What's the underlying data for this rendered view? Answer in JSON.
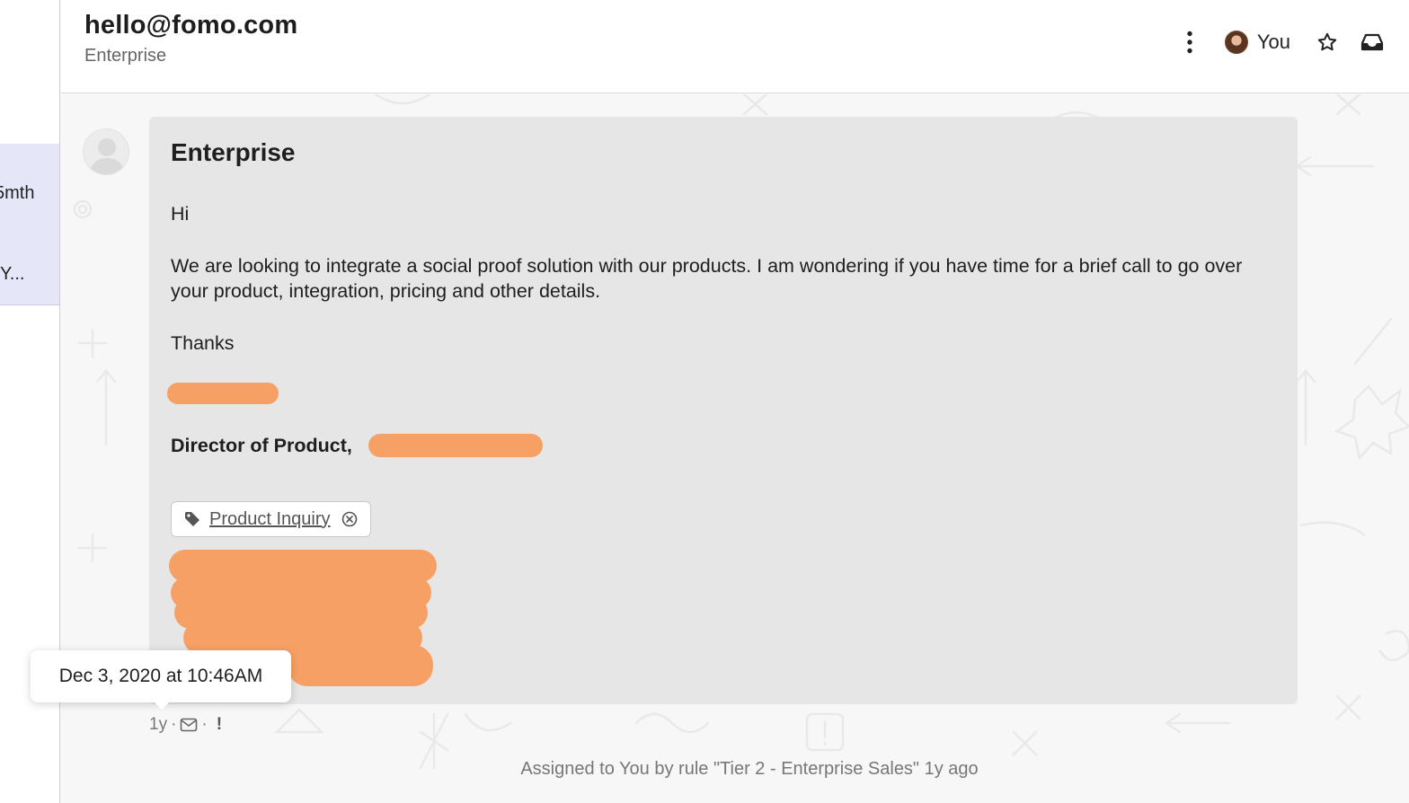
{
  "left_list": {
    "item_text_1": "5mth",
    "item_text_2": "Y..."
  },
  "header": {
    "title": "hello@fomo.com",
    "subtitle": "Enterprise",
    "more_icon": "kebab-vertical-icon",
    "assignee_label": "You",
    "star_icon": "star-icon",
    "inbox_icon": "inbox-icon"
  },
  "message": {
    "subject": "Enterprise",
    "body": [
      "Hi",
      "We are looking to integrate a social proof solution with our products. I am wondering if you have time for a brief call to go over your product, integration, pricing and other details.",
      "Thanks"
    ],
    "signature_title": "Director of Product, ",
    "tag": {
      "label": "Product Inquiry",
      "icon": "tag-icon",
      "remove_icon": "close-circle-icon"
    }
  },
  "tooltip": {
    "text": "Dec 3, 2020 at 10:46AM"
  },
  "meta": {
    "age": "1y",
    "separator": "·",
    "channel_icon": "email-icon",
    "priority_mark": "!"
  },
  "activity": {
    "text": "Assigned to You by rule \"Tier 2 - Enterprise Sales\" 1y ago"
  },
  "colors": {
    "redaction": "#f7a065",
    "selected_row": "#e6e6f9",
    "message_bg": "#e6e6e6"
  }
}
